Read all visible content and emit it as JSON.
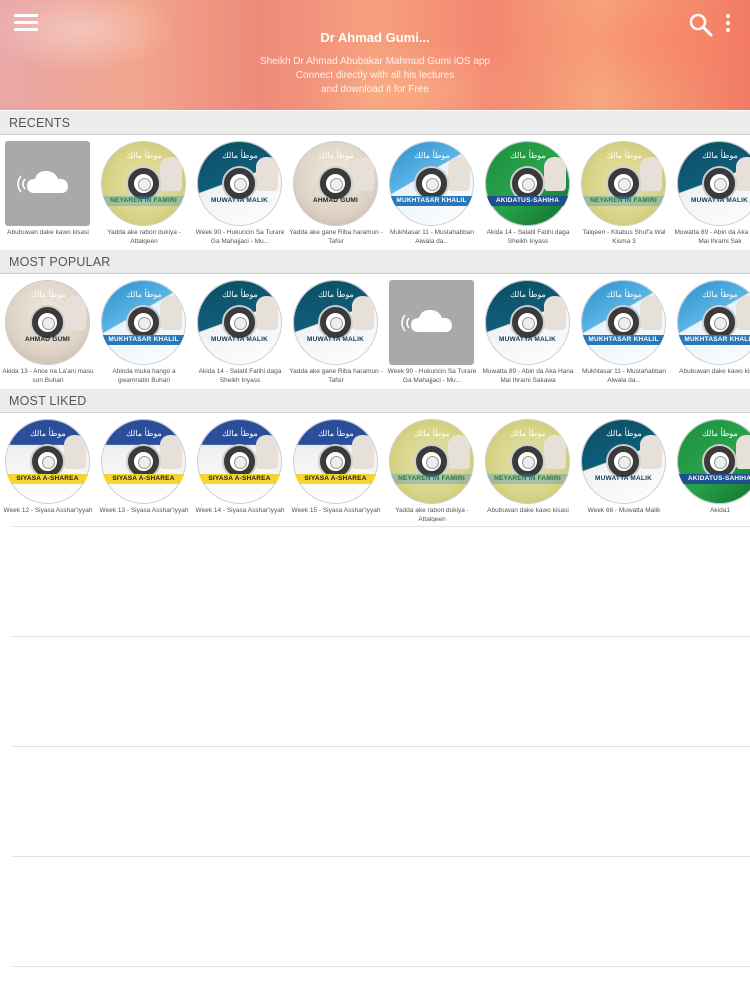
{
  "header": {
    "title": "Dr Ahmad Gumi...",
    "subtitle_lines": [
      "Sheikh Dr Ahmad Abubakar Mahmud Gumi iOS app",
      "Connect directly with all his lectures",
      "and download it for Free"
    ],
    "menu_icon": "hamburger-menu-icon",
    "search_icon": "search-icon",
    "more_icon": "more-vertical-icon",
    "colors": {
      "gradient_start": "#e9a7a7",
      "gradient_mid": "#f6a07e",
      "gradient_end": "#f27a64"
    }
  },
  "sections": [
    {
      "title": "RECENTS",
      "items": [
        {
          "label": "Abubuwan dake kawo kisasi",
          "thumb": "cloud",
          "disc_text": ""
        },
        {
          "label": "Yadda ake rabon dukiya - Attalqeen",
          "thumb": "yellow",
          "disc_text": "NEYAREN IN FAMIRI"
        },
        {
          "label": "Week 90 - Hukuncin Sa Turare Ga Mahajjaci - Mu...",
          "thumb": "teal",
          "disc_text": "MUWATTA MALIK"
        },
        {
          "label": "Yadda ake gane Riba haramun - Tafsir",
          "thumb": "tafsir",
          "disc_text": "AHMAD GUMI"
        },
        {
          "label": "Mukhtasar 11 - Mustahabban Alwala da...",
          "thumb": "blue",
          "disc_text": "MUKHTASAR KHALIL"
        },
        {
          "label": "Akida 14 - Salatil Fatihi daga Sheikh Inyass",
          "thumb": "green",
          "disc_text": "AKIDATUS-SAHIHA"
        },
        {
          "label": "Talqeen - Kitabus Shuf'a Wal Kisma 3",
          "thumb": "yellow",
          "disc_text": "NEYAREN IN FAMIRI"
        },
        {
          "label": "Muwatta 89 - Abin da Aka Hana Mai Ihrami Sak",
          "thumb": "teal",
          "disc_text": "MUWATTA MALIK"
        }
      ]
    },
    {
      "title": "MOST POPULAR",
      "items": [
        {
          "label": "Akida 13 - Ance na La'ani masu son Buhari",
          "thumb": "tafsir",
          "disc_text": "AHMAD GUMI"
        },
        {
          "label": "Abinda muka hango a gwamnatin Buhari",
          "thumb": "blue",
          "disc_text": "MUKHTASAR KHALIL"
        },
        {
          "label": "Akida 14 - Salatil Fatihi daga Sheikh Inyass",
          "thumb": "teal",
          "disc_text": "MUWATTA MALIK"
        },
        {
          "label": "Yadda ake gane Riba haramun - Tafsir",
          "thumb": "teal",
          "disc_text": "MUWATTA MALIK"
        },
        {
          "label": "Week 90 - Hukuncin Sa Turare Ga Mahajjaci - Mu...",
          "thumb": "cloud",
          "disc_text": ""
        },
        {
          "label": "Muwatta 89 - Abin da Aka Hana Mai Ihrami Sakawa",
          "thumb": "teal",
          "disc_text": "MUWATTA MALIK"
        },
        {
          "label": "Mukhtasar 11 - Mustahabban Alwala da...",
          "thumb": "blue",
          "disc_text": "MUKHTASAR KHALIL"
        },
        {
          "label": "Abubuwan dake kawo kisasi",
          "thumb": "blue",
          "disc_text": "MUKHTASAR KHALIL"
        }
      ]
    },
    {
      "title": "MOST LIKED",
      "items": [
        {
          "label": "Week 12 - Siyasa Asshar'iyyah",
          "thumb": "siyasa",
          "disc_text": "SIYASA A-SHAREA"
        },
        {
          "label": "Week 13 - Siyasa Asshar'iyyah",
          "thumb": "siyasa",
          "disc_text": "SIYASA A-SHAREA"
        },
        {
          "label": "Week 14 - Siyasa Asshar'iyyah",
          "thumb": "siyasa",
          "disc_text": "SIYASA A-SHAREA"
        },
        {
          "label": "Week 15 - Siyasa Asshar'iyyah",
          "thumb": "siyasa",
          "disc_text": "SIYASA A-SHAREA"
        },
        {
          "label": "Yadda ake rabon dukiya - Attalqeen",
          "thumb": "yellow",
          "disc_text": "NEYAREN IN FAMIRI"
        },
        {
          "label": "Abubuwan dake kawo kisasi",
          "thumb": "yellow",
          "disc_text": "NEYAREN IN FAMIRI"
        },
        {
          "label": "Week 66 - Muwatta Malik",
          "thumb": "teal",
          "disc_text": "MUWATTA MALIK"
        },
        {
          "label": "Akida1",
          "thumb": "green",
          "disc_text": "AKIDATUS-SAHIHA"
        }
      ]
    }
  ]
}
